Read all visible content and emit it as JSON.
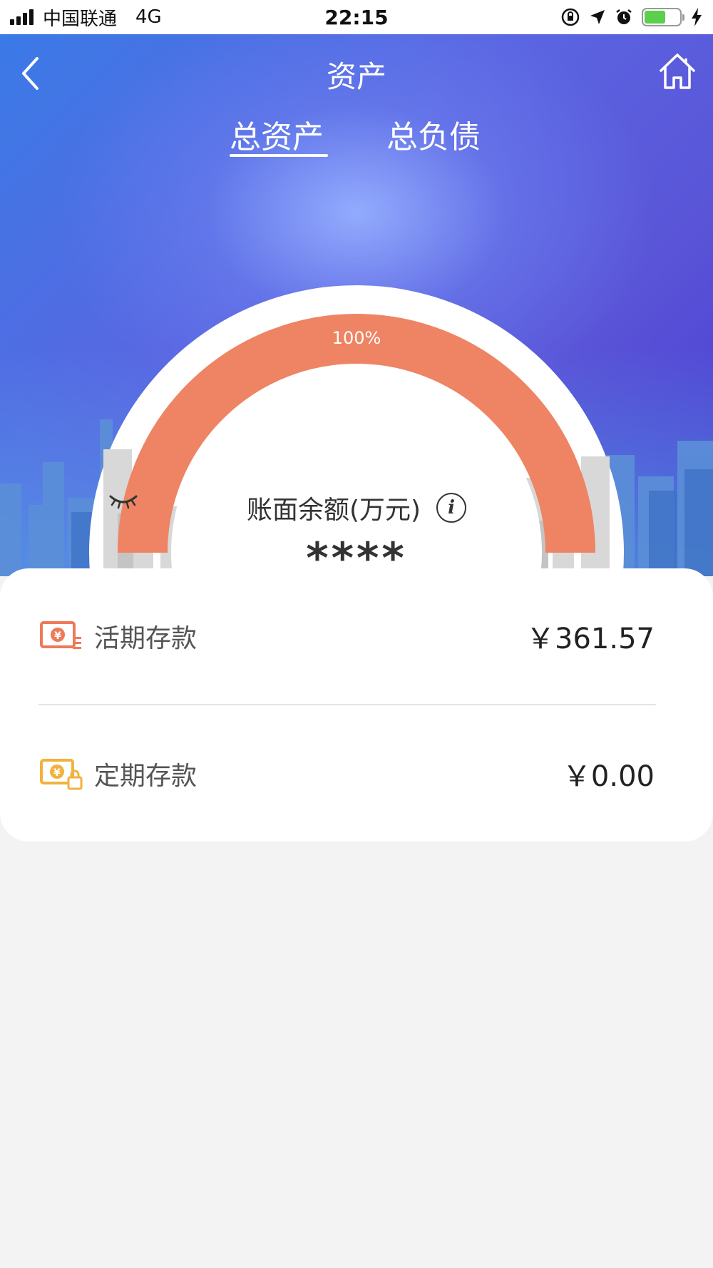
{
  "status_bar": {
    "carrier": "中国联通",
    "network": "4G",
    "time": "22:15",
    "battery_level": 0.6,
    "battery_color": "#5cd04c"
  },
  "nav": {
    "back_icon": "chevron-left-icon",
    "title": "资产",
    "home_icon": "home-icon"
  },
  "tabs": [
    {
      "label": "总资产",
      "active": true
    },
    {
      "label": "总负债",
      "active": false
    }
  ],
  "gauge": {
    "percent_label": "100%",
    "percent": 1.0,
    "arc_color": "#ee8463",
    "balance_label": "账面余额(万元)",
    "balance_value": "****",
    "info_icon": "info-icon",
    "eye_icon": "eye-closed-icon"
  },
  "accounts": [
    {
      "label": "活期存款",
      "amount": "￥361.57",
      "icon": "cash-icon",
      "icon_color": "#ee7a5a"
    },
    {
      "label": "定期存款",
      "amount": "￥0.00",
      "icon": "locked-cash-icon",
      "icon_color": "#f2b23d"
    }
  ],
  "colors": {
    "accent": "#ee8463",
    "header_blue": "#4a6ae0"
  }
}
